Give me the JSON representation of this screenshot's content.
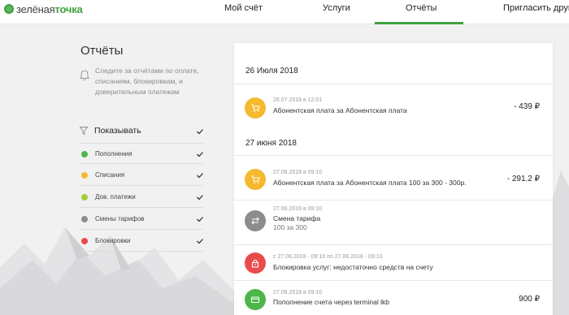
{
  "header": {
    "logo_part1": "зелёная",
    "logo_part2": "точка",
    "nav": [
      {
        "label": "Мой счёт"
      },
      {
        "label": "Услуги"
      },
      {
        "label": "Отчёты"
      },
      {
        "label": "Пригласить друга"
      }
    ],
    "active_tab": "Отчёты"
  },
  "left": {
    "title": "Отчёты",
    "description": "Следите за отчётами по оплате, списаниям, блокировкам, и доверительным платежам",
    "filter_label": "Показывать",
    "filters": [
      {
        "label": "Пополнения",
        "color": "#4cb648",
        "checked": true
      },
      {
        "label": "Списания",
        "color": "#f5b92e",
        "checked": true
      },
      {
        "label": "Дов. платежи",
        "color": "#a5cd3a",
        "checked": true
      },
      {
        "label": "Смены тарифов",
        "color": "#8c8c8c",
        "checked": true
      },
      {
        "label": "Блокировки",
        "color": "#e94b4b",
        "checked": true
      }
    ]
  },
  "report": {
    "groups": [
      {
        "date": "26 Июля 2018",
        "items": [
          {
            "icon": "cart-icon",
            "color": "#f5b92e",
            "meta": "26.07.2018 в 12:01",
            "title": "Абонентская плата за Абонентская плата",
            "sub": "",
            "amount": "- 439 ₽"
          }
        ]
      },
      {
        "date": "27 июня 2018",
        "items": [
          {
            "icon": "cart-icon",
            "color": "#f5b92e",
            "meta": "27.06.2018 в 09:10",
            "title": "Абонентская плата за Абонентская плата 100 за 300 - 300р.",
            "sub": "",
            "amount": "- 291.2 ₽"
          },
          {
            "icon": "swap-arrows-icon",
            "color": "#8c8c8c",
            "meta": "27.06.2018 в 09:10",
            "title": "Смена тарифа",
            "sub": "100 за 300",
            "amount": ""
          },
          {
            "icon": "lock-icon",
            "color": "#e94b4b",
            "meta": "с 27.06.2018 - 09:10 по 27.06.2018 - 09:10",
            "title": "Блокировка услуг: недостаточно средств на счету",
            "sub": "",
            "amount": ""
          },
          {
            "icon": "card-icon",
            "color": "#4cb648",
            "meta": "27.06.2018 в 09:10",
            "title": "Пополнение счета через terminal lkb",
            "sub": "",
            "amount": "900 ₽"
          }
        ]
      }
    ]
  }
}
